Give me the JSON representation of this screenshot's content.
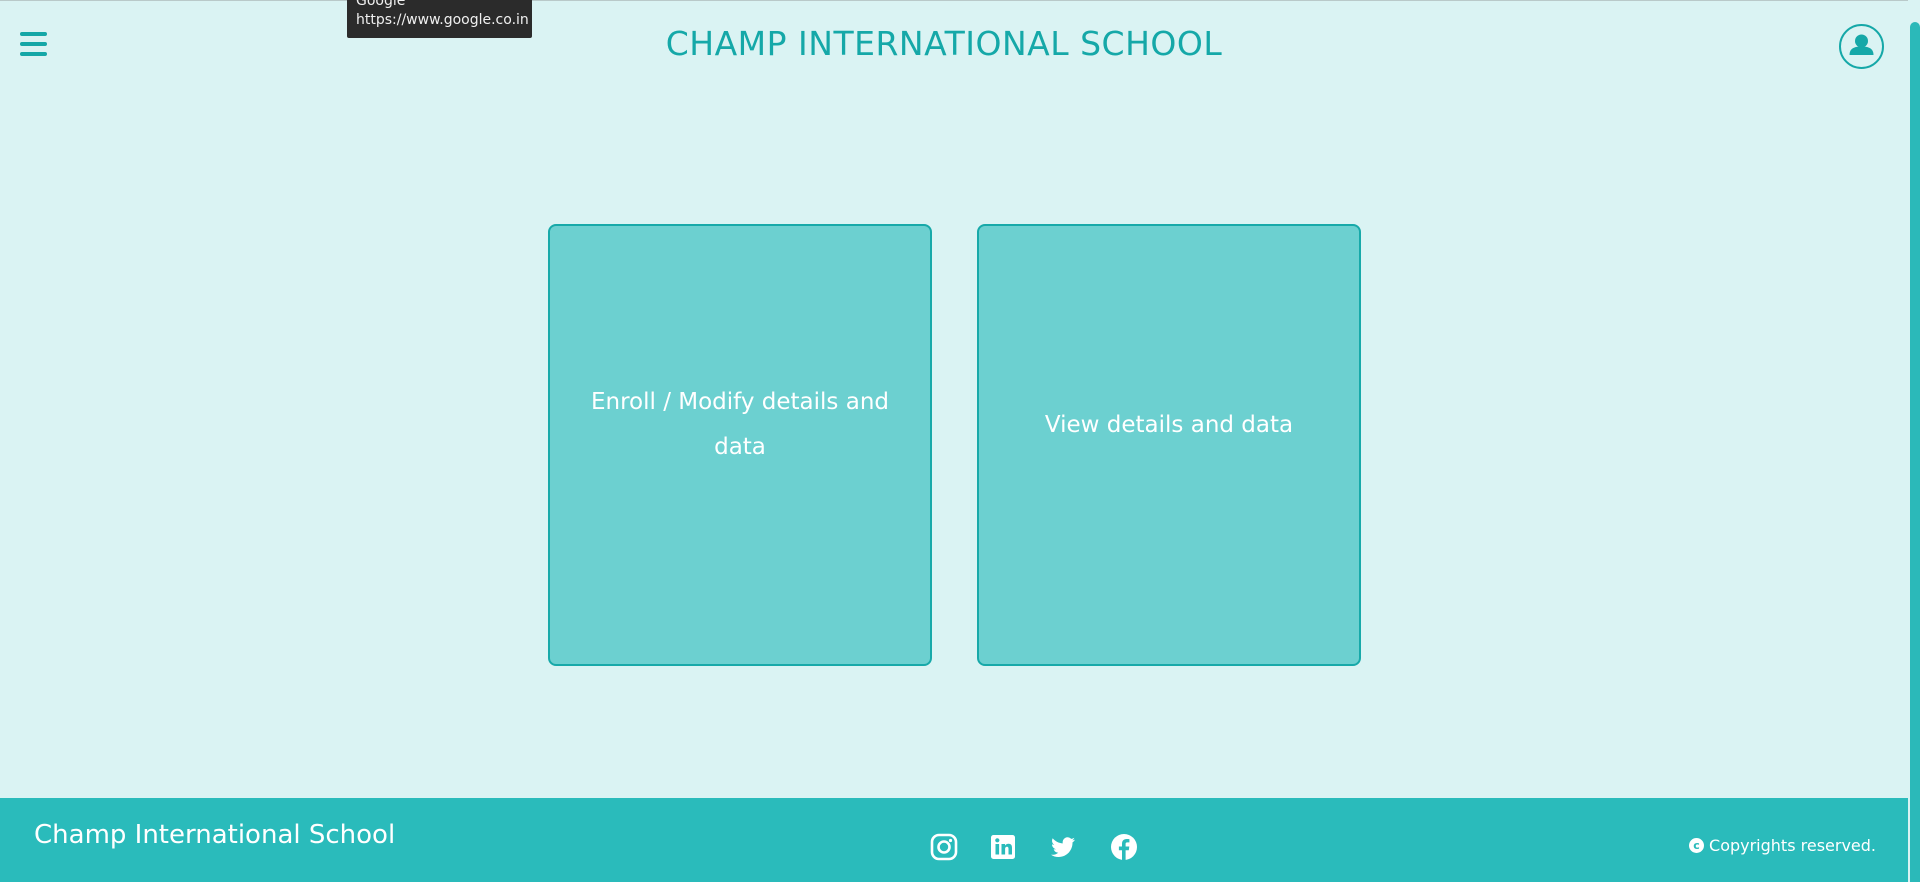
{
  "header": {
    "title": "CHAMP INTERNATIONAL SCHOOL",
    "menu_icon": "hamburger-menu-icon",
    "profile_icon": "user-profile-icon"
  },
  "tooltip": {
    "line1": "Google",
    "line2": "https://www.google.co.in"
  },
  "cards": [
    {
      "label": "Enroll / Modify details and data"
    },
    {
      "label": "View details and data"
    }
  ],
  "footer": {
    "brand": "Champ International School",
    "social_icons": [
      "instagram-icon",
      "linkedin-icon",
      "twitter-icon",
      "facebook-icon"
    ],
    "copyright_icon": "copyright-icon",
    "copyright_symbol": "c",
    "copyright": "Copyrights reserved."
  },
  "colors": {
    "background": "#daf3f3",
    "accent": "#15a8a8",
    "card": "#6cd0d0",
    "footer": "#2abbbb"
  }
}
